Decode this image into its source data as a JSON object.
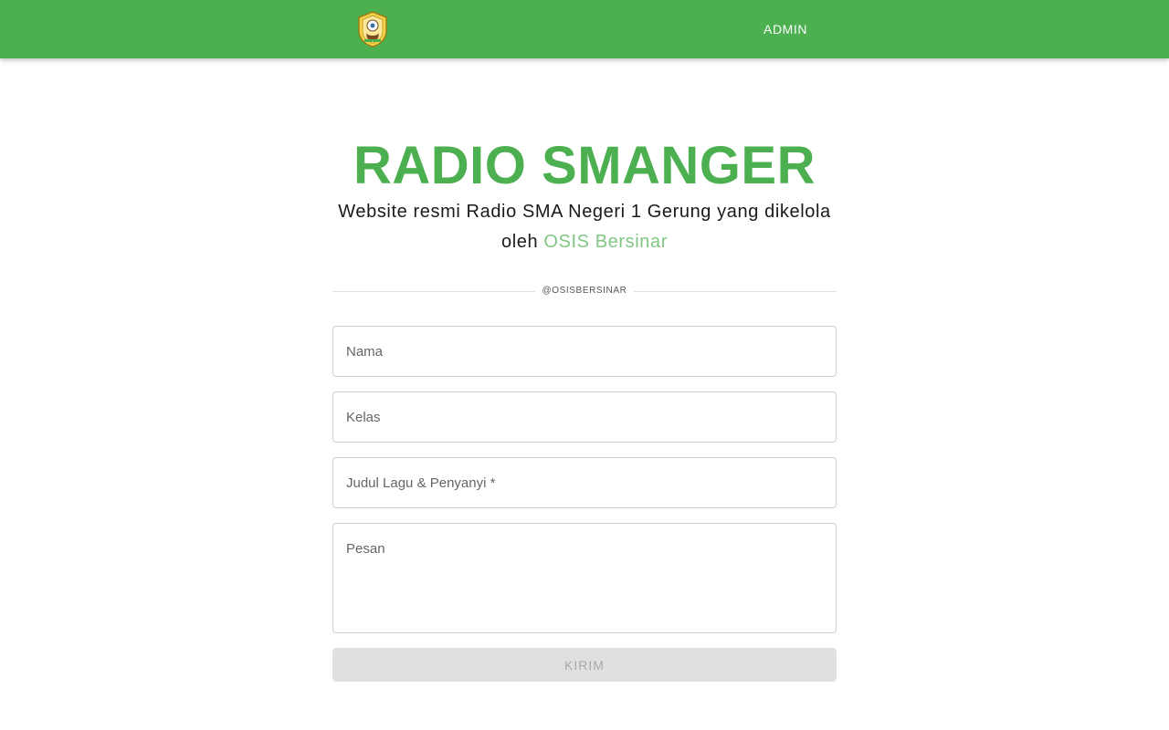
{
  "appbar": {
    "logo_icon": "school-emblem-icon",
    "admin_label": "ADMIN",
    "color": "#4caf50"
  },
  "hero": {
    "title": "RADIO SMANGER",
    "subtitle_text": "Website resmi Radio SMA Negeri 1 Gerung yang dikelola oleh ",
    "subtitle_link": "OSIS Bersinar",
    "link_color": "#81c784"
  },
  "divider": {
    "label": "@OSISBERSINAR"
  },
  "form": {
    "nama": {
      "placeholder": "Nama",
      "value": ""
    },
    "kelas": {
      "placeholder": "Kelas",
      "value": ""
    },
    "judul": {
      "placeholder": "Judul Lagu & Penyanyi *",
      "value": ""
    },
    "pesan": {
      "placeholder": "Pesan",
      "value": ""
    },
    "submit_label": "KIRIM"
  }
}
